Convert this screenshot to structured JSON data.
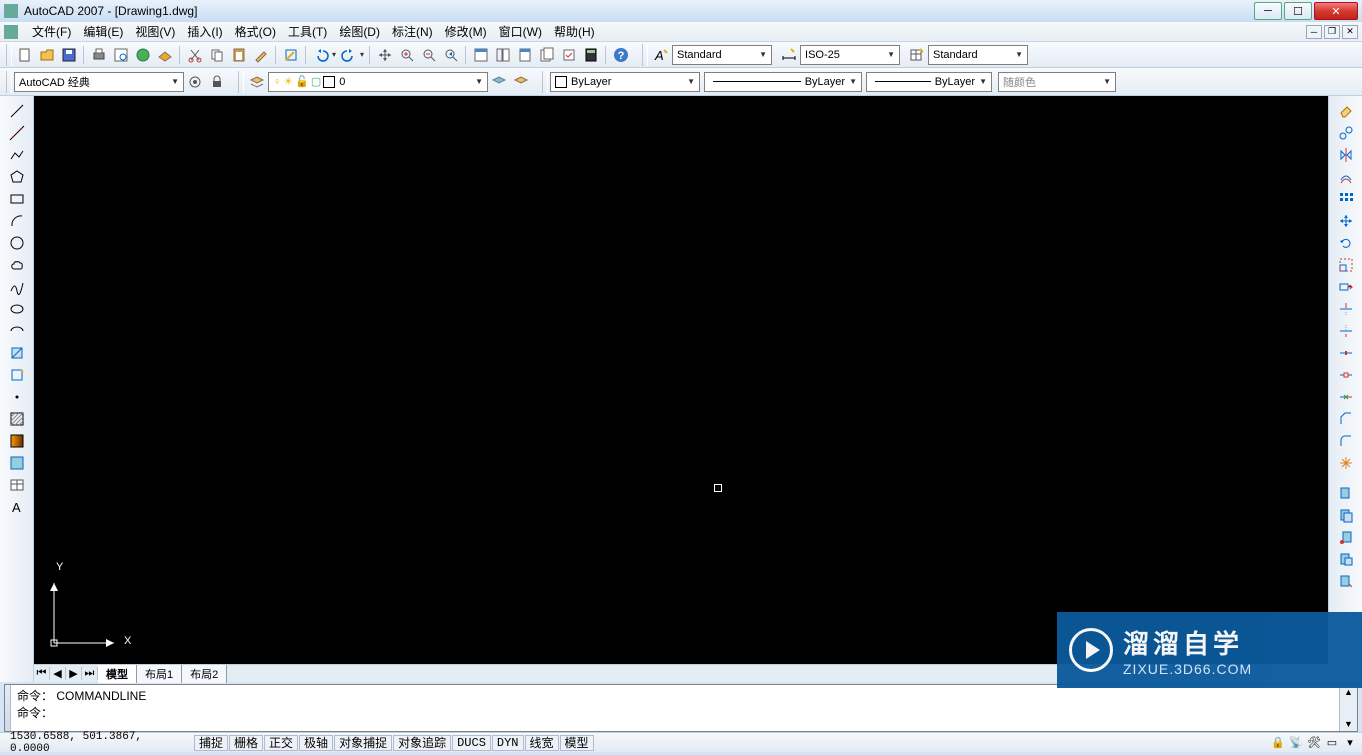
{
  "title": "AutoCAD 2007 - [Drawing1.dwg]",
  "menu": {
    "items": [
      "文件(F)",
      "编辑(E)",
      "视图(V)",
      "插入(I)",
      "格式(O)",
      "工具(T)",
      "绘图(D)",
      "标注(N)",
      "修改(M)",
      "窗口(W)",
      "帮助(H)"
    ]
  },
  "styles": {
    "text_style": "Standard",
    "dim_style": "ISO-25",
    "table_style": "Standard"
  },
  "workspace": "AutoCAD 经典",
  "layer": {
    "current": "0"
  },
  "properties": {
    "color": "ByLayer",
    "linetype": "ByLayer",
    "lineweight": "ByLayer",
    "plotstyle": "随颜色"
  },
  "model_tabs": [
    "模型",
    "布局1",
    "布局2"
  ],
  "command": {
    "history": "命令： COMMANDLINE",
    "prompt": "命令："
  },
  "status": {
    "coords": "1530.6588, 501.3867, 0.0000",
    "toggles": [
      "捕捉",
      "栅格",
      "正交",
      "极轴",
      "对象捕捉",
      "对象追踪",
      "DUCS",
      "DYN",
      "线宽",
      "模型"
    ]
  },
  "ucs": {
    "x": "X",
    "y": "Y"
  },
  "watermark": {
    "main": "溜溜自学",
    "sub": "ZIXUE.3D66.COM"
  }
}
